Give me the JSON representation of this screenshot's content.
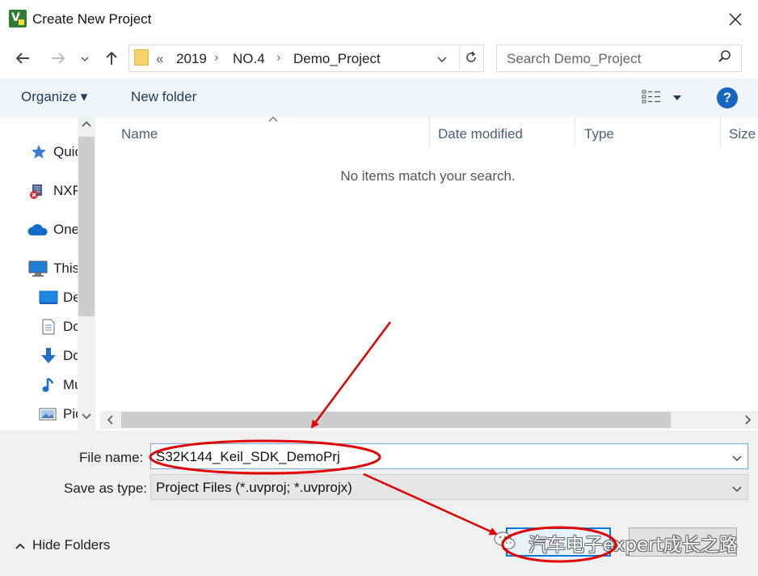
{
  "window": {
    "title": "Create New Project",
    "app_icon": "uvision-icon",
    "close_icon": "close-icon"
  },
  "nav": {
    "back_icon": "back-arrow-icon",
    "forward_icon": "forward-arrow-icon",
    "recent_icon": "chevron-down-icon",
    "up_icon": "up-arrow-icon"
  },
  "address": {
    "overflow": "«",
    "crumbs": [
      "2019",
      "NO.4",
      "Demo_Project"
    ],
    "separator": "›"
  },
  "search": {
    "placeholder": "Search Demo_Project"
  },
  "toolbar": {
    "organize": "Organize ▾",
    "new_folder": "New folder",
    "help": "?"
  },
  "sidebar": {
    "items": [
      {
        "label": "Quick access",
        "icon": "star-icon"
      },
      {
        "label": "NXP",
        "icon": "nxp-icon"
      },
      {
        "label": "OneDrive",
        "icon": "cloud-icon"
      },
      {
        "label": "This PC",
        "icon": "computer-icon"
      },
      {
        "label": "Desktop",
        "icon": "desktop-icon"
      },
      {
        "label": "Documents",
        "icon": "document-icon"
      },
      {
        "label": "Downloads",
        "icon": "download-icon"
      },
      {
        "label": "Music",
        "icon": "music-icon"
      },
      {
        "label": "Pictures",
        "icon": "picture-icon"
      }
    ]
  },
  "filelist": {
    "columns": [
      "Name",
      "Date modified",
      "Type",
      "Size"
    ],
    "sorted_column": "Name",
    "empty_message": "No items match your search."
  },
  "form": {
    "file_name_label": "File name:",
    "file_name_value": "S32K144_Keil_SDK_DemoPrj",
    "save_type_label": "Save as type:",
    "save_type_value": "Project Files (*.uvproj; *.uvprojx)"
  },
  "footer": {
    "hide_folders": "Hide Folders"
  },
  "watermark": {
    "text": "汽车电子expert成长之路",
    "logo": "wechat-icon"
  },
  "colors": {
    "toolbar_bg": "#f0f5fa",
    "accent": "#0078d7",
    "annotation_red": "#e00000"
  }
}
